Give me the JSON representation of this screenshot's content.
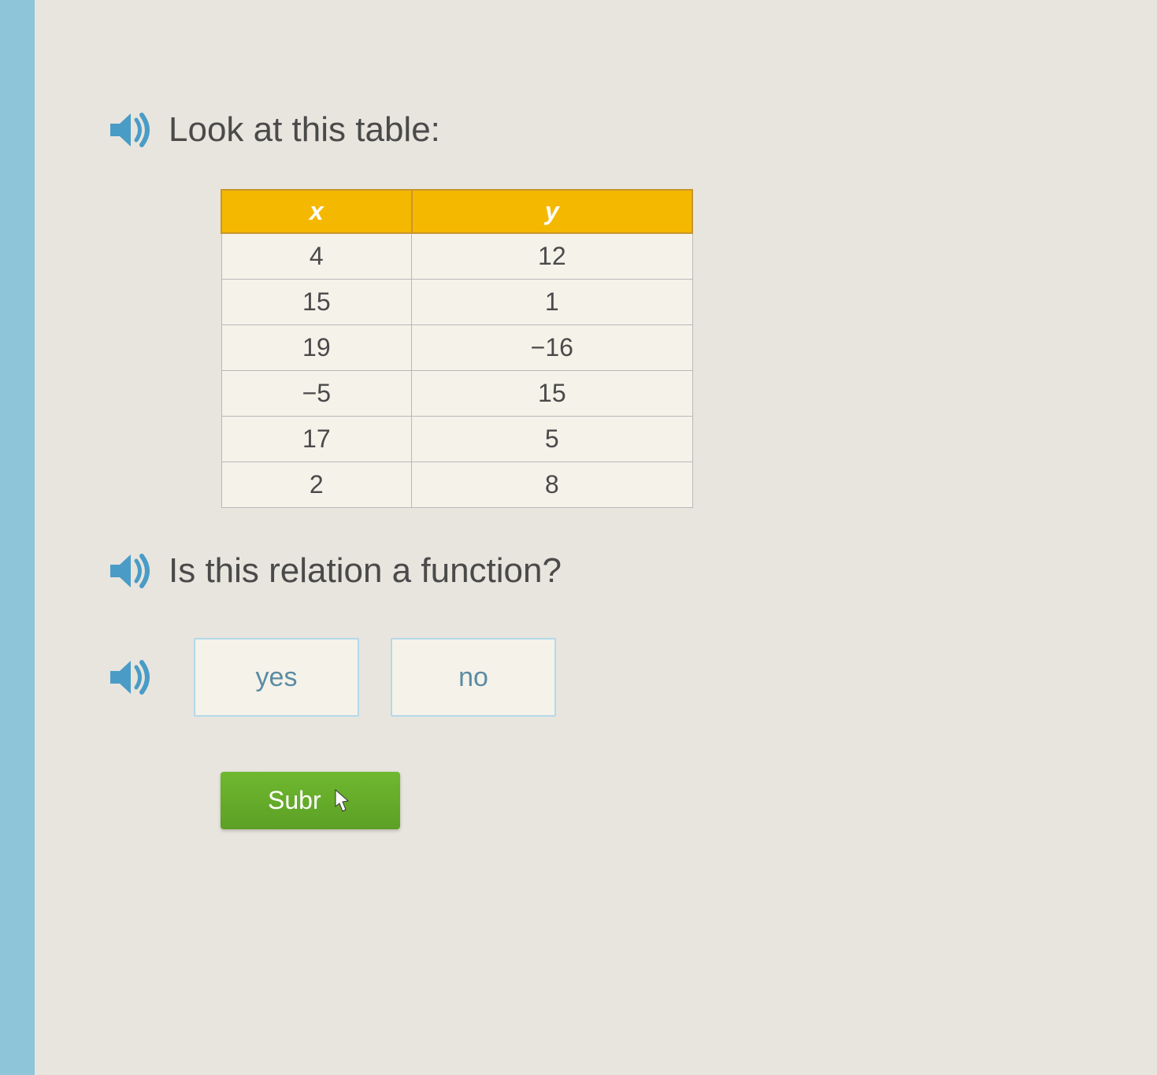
{
  "prompt1": "Look at this table:",
  "prompt2": "Is this relation a function?",
  "table": {
    "headers": {
      "col1": "x",
      "col2": "y"
    },
    "rows": [
      {
        "x": "4",
        "y": "12"
      },
      {
        "x": "15",
        "y": "1"
      },
      {
        "x": "19",
        "y": "−16"
      },
      {
        "x": "−5",
        "y": "15"
      },
      {
        "x": "17",
        "y": "5"
      },
      {
        "x": "2",
        "y": "8"
      }
    ]
  },
  "options": {
    "yes": "yes",
    "no": "no"
  },
  "submit_label": "Subr"
}
